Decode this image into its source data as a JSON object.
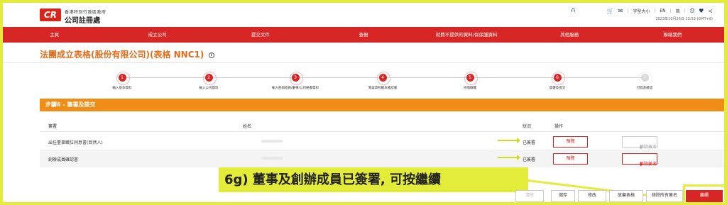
{
  "header": {
    "logo_mark": "CR",
    "logo_subtitle": "香港特別行政區政府",
    "logo_title": "公司註冊處",
    "font_size_label": "字型大小",
    "lang_en": "EN",
    "lang_sc": "简",
    "datetime": "2023年10月26日 13:53 (GMT+8)"
  },
  "nav": {
    "items": [
      "主頁",
      "成立公司",
      "提交文件",
      "查冊",
      "就費不提供的資料/保保護資料",
      "其他服務",
      "聯絡我們"
    ]
  },
  "page": {
    "title": "法團成立表格(股份有限公司)(表格 NNC1)"
  },
  "stepper": {
    "steps": [
      {
        "num": "1",
        "label": "輸入基本資料",
        "active": true
      },
      {
        "num": "2",
        "label": "輸入公司資料",
        "active": true
      },
      {
        "num": "3",
        "label": "輸入創辦成員/董事/公司秘書資料",
        "active": true
      },
      {
        "num": "4",
        "label": "我與章程範本確認書",
        "active": true
      },
      {
        "num": "5",
        "label": "詳情概覽",
        "active": true
      },
      {
        "num": "6",
        "label": "簽署及提交",
        "active": true
      },
      {
        "num": "7",
        "label": "付款及確認",
        "active": false
      }
    ]
  },
  "section": {
    "title": "步驟6 - 簽署及提交"
  },
  "table": {
    "headers": [
      "簽署",
      "姓名",
      "狀況",
      "操作"
    ],
    "rows": [
      {
        "role": "出任董事職位同意書(目然人)",
        "status": "已簽署",
        "preview": "預覽",
        "remove": "移除簽名",
        "remove_active": false
      },
      {
        "role": "創辦成員確認書",
        "status": "已簽署",
        "preview": "預覽",
        "remove": "移除簽名",
        "remove_active": true
      }
    ]
  },
  "annotation": {
    "text": "6g) 董事及創辦成員已簽署, 可按繼續"
  },
  "buttons": {
    "clear": "清除",
    "save": "儲存",
    "modify": "修改",
    "abandon": "放棄表格",
    "remove_all": "移除所有簽名",
    "next": "繼續"
  },
  "colors": {
    "brand_red": "#d62626",
    "section_orange": "#ef8d16",
    "highlight_yellow": "#e4ec3a"
  }
}
